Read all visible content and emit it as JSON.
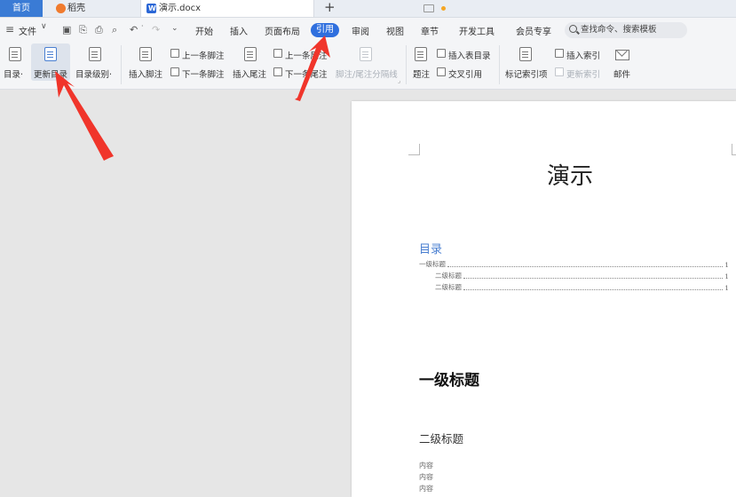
{
  "tabs": {
    "home": "首页",
    "daoke": "稻壳",
    "document": "演示.docx",
    "new_tab": "+"
  },
  "menu": {
    "file": "文件",
    "items": [
      "开始",
      "插入",
      "页面布局",
      "引用",
      "审阅",
      "视图",
      "章节",
      "开发工具",
      "会员专享"
    ],
    "active": "引用",
    "search_placeholder": "查找命令、搜索模板"
  },
  "ribbon": {
    "toc": "目录·",
    "update_toc": "更新目录",
    "toc_level": "目录级别·",
    "insert_footnote": "插入脚注",
    "prev_footnote": "上一条脚注",
    "next_footnote": "下一条脚注",
    "insert_endnote": "插入尾注",
    "prev_endnote": "上一条尾注",
    "next_endnote": "下一条尾注",
    "separator": "脚注/尾注分隔线",
    "caption": "题注",
    "insert_table_of_figures": "插入表目录",
    "cross_reference": "交叉引用",
    "mark_index_entry": "标记索引项",
    "insert_index": "插入索引",
    "update_index": "更新索引",
    "mail": "邮件"
  },
  "document": {
    "title": "演示",
    "toc_heading": "目录",
    "toc_entries": [
      {
        "text": "一级标题",
        "page": "1",
        "level": 1
      },
      {
        "text": "二级标题",
        "page": "1",
        "level": 2
      },
      {
        "text": "二级标题",
        "page": "1",
        "level": 2
      }
    ],
    "heading1": "一级标题",
    "heading2": "二级标题",
    "body_lines": [
      "内容",
      "内容",
      "内容"
    ]
  },
  "colors": {
    "accent": "#2f6fde",
    "annotation_arrow": "#f0352b",
    "toc_heading": "#4a7fd1"
  }
}
